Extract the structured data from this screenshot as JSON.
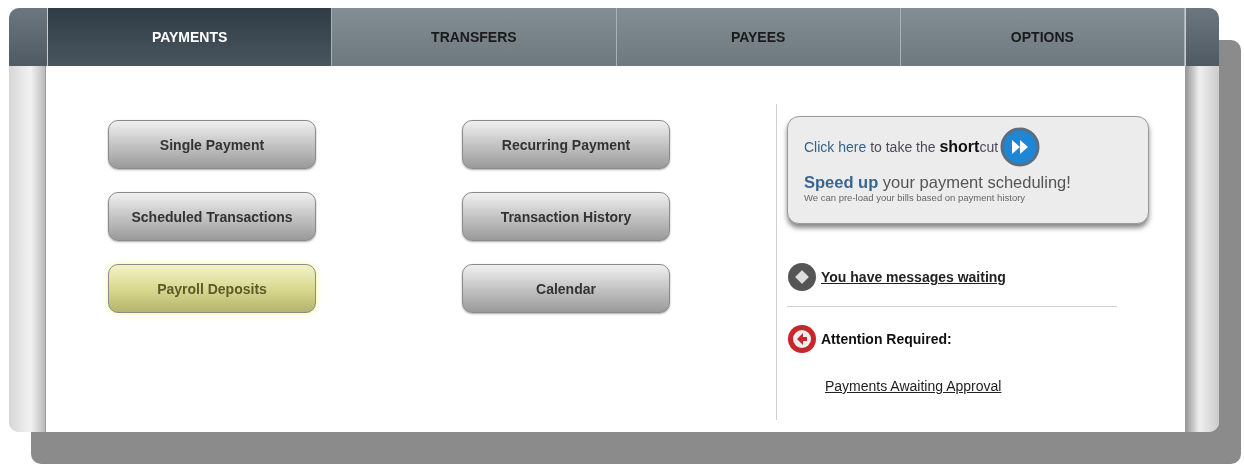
{
  "tabs": [
    {
      "label": "PAYMENTS",
      "selected": true
    },
    {
      "label": "TRANSFERS",
      "selected": false
    },
    {
      "label": "PAYEES",
      "selected": false
    },
    {
      "label": "OPTIONS",
      "selected": false
    }
  ],
  "buttons": [
    {
      "label": "Single Payment",
      "selected": false
    },
    {
      "label": "Recurring Payment",
      "selected": false
    },
    {
      "label": "Scheduled Transactions",
      "selected": false
    },
    {
      "label": "Transaction History",
      "selected": false
    },
    {
      "label": "Payroll Deposits",
      "selected": true
    },
    {
      "label": "Calendar",
      "selected": false
    }
  ],
  "promo": {
    "link": "Click here",
    "text": "to take the **short**cut",
    "headline": "**Speed up** your payment scheduling!",
    "note": "We can pre-load your bills based on payment history"
  },
  "messages_link": "You have messages waiting",
  "attention": {
    "title": "Attention Required:",
    "link": "Payments Awaiting Approval"
  }
}
